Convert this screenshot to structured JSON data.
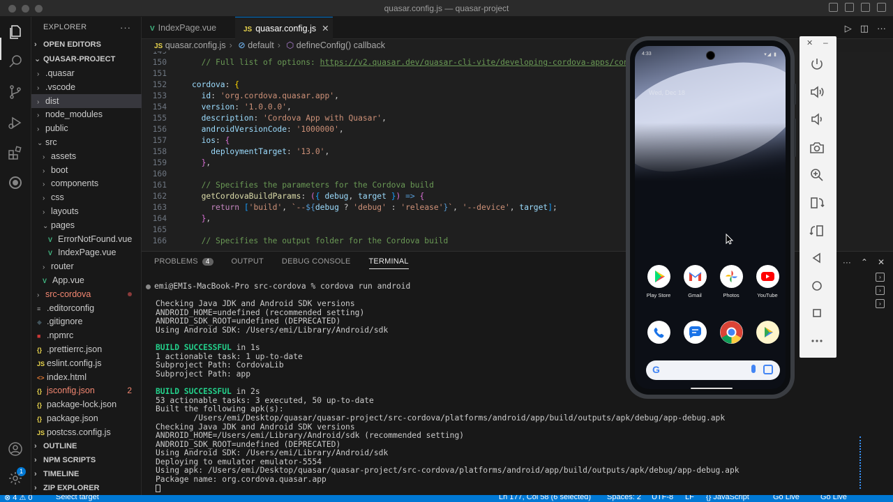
{
  "window": {
    "title": "quasar.config.js — quasar-project"
  },
  "explorer": {
    "header": "EXPLORER",
    "open_editors": "OPEN EDITORS",
    "project": "QUASAR-PROJECT",
    "tree": [
      {
        "label": ".quasar",
        "depth": 1,
        "kind": "folder"
      },
      {
        "label": ".vscode",
        "depth": 1,
        "kind": "folder"
      },
      {
        "label": "dist",
        "depth": 1,
        "kind": "folder",
        "selected": true
      },
      {
        "label": "node_modules",
        "depth": 1,
        "kind": "folder"
      },
      {
        "label": "public",
        "depth": 1,
        "kind": "folder"
      },
      {
        "label": "src",
        "depth": 1,
        "kind": "folder-open"
      },
      {
        "label": "assets",
        "depth": 2,
        "kind": "folder"
      },
      {
        "label": "boot",
        "depth": 2,
        "kind": "folder"
      },
      {
        "label": "components",
        "depth": 2,
        "kind": "folder"
      },
      {
        "label": "css",
        "depth": 2,
        "kind": "folder"
      },
      {
        "label": "layouts",
        "depth": 2,
        "kind": "folder"
      },
      {
        "label": "pages",
        "depth": 2,
        "kind": "folder-open"
      },
      {
        "label": "ErrorNotFound.vue",
        "depth": 3,
        "kind": "vue"
      },
      {
        "label": "IndexPage.vue",
        "depth": 3,
        "kind": "vue"
      },
      {
        "label": "router",
        "depth": 2,
        "kind": "folder"
      },
      {
        "label": "App.vue",
        "depth": 2,
        "kind": "vue"
      },
      {
        "label": "src-cordova",
        "depth": 1,
        "kind": "folder",
        "error": true
      },
      {
        "label": ".editorconfig",
        "depth": 1,
        "kind": "config"
      },
      {
        "label": ".gitignore",
        "depth": 1,
        "kind": "git"
      },
      {
        "label": ".npmrc",
        "depth": 1,
        "kind": "npm"
      },
      {
        "label": ".prettierrc.json",
        "depth": 1,
        "kind": "json"
      },
      {
        "label": "eslint.config.js",
        "depth": 1,
        "kind": "js"
      },
      {
        "label": "index.html",
        "depth": 1,
        "kind": "html"
      },
      {
        "label": "jsconfig.json",
        "depth": 1,
        "kind": "json",
        "error": true,
        "count": "2"
      },
      {
        "label": "package-lock.json",
        "depth": 1,
        "kind": "json"
      },
      {
        "label": "package.json",
        "depth": 1,
        "kind": "json"
      },
      {
        "label": "postcss.config.js",
        "depth": 1,
        "kind": "js"
      }
    ],
    "sections": [
      "OUTLINE",
      "NPM SCRIPTS",
      "TIMELINE",
      "ZIP EXPLORER"
    ]
  },
  "tabs": [
    {
      "label": "IndexPage.vue",
      "icon": "V",
      "active": false
    },
    {
      "label": "quasar.config.js",
      "icon": "JS",
      "active": true
    }
  ],
  "breadcrumb": [
    "quasar.config.js",
    "default",
    "defineConfig() callback"
  ],
  "editor": {
    "lines": [
      {
        "n": "149",
        "text": ""
      },
      {
        "n": "150",
        "text": "// Full list of options: https://v2.quasar.dev/quasar-cli-vite/developing-cordova-apps/configuring-cordova"
      },
      {
        "n": "151",
        "text": ""
      },
      {
        "n": "152",
        "text": "cordova: {"
      },
      {
        "n": "153",
        "text": "id: 'org.cordova.quasar.app',"
      },
      {
        "n": "154",
        "text": "version: '1.0.0.0',"
      },
      {
        "n": "155",
        "text": "description: 'Cordova App with Quasar',"
      },
      {
        "n": "156",
        "text": "androidVersionCode: '1000000',"
      },
      {
        "n": "157",
        "text": "ios: {"
      },
      {
        "n": "158",
        "text": "deploymentTarget: '13.0',"
      },
      {
        "n": "159",
        "text": "},"
      },
      {
        "n": "160",
        "text": ""
      },
      {
        "n": "161",
        "text": "// Specifies the parameters for the Cordova build"
      },
      {
        "n": "162",
        "text": "getCordovaBuildParams: ({ debug, target }) => {"
      },
      {
        "n": "163",
        "text": "return ['build', `--${debug ? 'debug' : 'release'}`, '--device', target];"
      },
      {
        "n": "164",
        "text": "},"
      },
      {
        "n": "165",
        "text": ""
      },
      {
        "n": "166",
        "text": "// Specifies the output folder for the Cordova build"
      }
    ]
  },
  "panel": {
    "tabs": [
      "PROBLEMS",
      "OUTPUT",
      "DEBUG CONSOLE",
      "TERMINAL"
    ],
    "problems_count": "4",
    "active_tab": "TERMINAL",
    "terminal": [
      "emi@EMIs-MacBook-Pro src-cordova % cordova run android",
      "",
      "Checking Java JDK and Android SDK versions",
      "ANDROID_HOME=undefined (recommended setting)",
      "ANDROID_SDK_ROOT=undefined (DEPRECATED)",
      "Using Android SDK: /Users/emi/Library/Android/sdk",
      "",
      "BUILD SUCCESSFUL in 1s",
      "1 actionable task: 1 up-to-date",
      "Subproject Path: CordovaLib",
      "Subproject Path: app",
      "",
      "BUILD SUCCESSFUL in 2s",
      "53 actionable tasks: 3 executed, 50 up-to-date",
      "Built the following apk(s):",
      "        /Users/emi/Desktop/quasar/quasar-project/src-cordova/platforms/android/app/build/outputs/apk/debug/app-debug.apk",
      "Checking Java JDK and Android SDK versions",
      "ANDROID_HOME=/Users/emi/Library/Android/sdk (recommended setting)",
      "ANDROID_SDK_ROOT=undefined (DEPRECATED)",
      "Using Android SDK: /Users/emi/Library/Android/sdk",
      "Deploying to emulator emulator-5554",
      "Using apk: /Users/emi/Desktop/quasar/quasar-project/src-cordova/platforms/android/app/build/outputs/apk/debug/app-debug.apk",
      "Package name: org.cordova.quasar.app",
      ""
    ]
  },
  "statusbar": {
    "problems": "⊗ 4 ⚠ 0",
    "select_target": "Select target",
    "position": "Ln 177, Col 58 (6 selected)",
    "spaces": "Spaces: 2",
    "encoding": "UTF-8",
    "eol": "LF",
    "language": "{} JavaScript",
    "golive1": "Go Live",
    "golive2": "Go Live"
  },
  "phone": {
    "time": "4:33",
    "status": "▾◢ ▮",
    "date": "Wed, Dec 18",
    "apps_row1": [
      "Play Store",
      "Gmail",
      "Photos",
      "YouTube"
    ],
    "apps_row2": [
      "phone-icon",
      "messages-icon",
      "chrome-icon",
      "play-games-icon"
    ]
  },
  "emulator_controls": [
    "power",
    "volume-up",
    "volume-down",
    "camera",
    "zoom",
    "rotate-left",
    "rotate-right",
    "back",
    "home",
    "overview",
    "more"
  ],
  "colors": {
    "accent": "#0078d4",
    "status_bar": "#0078d4",
    "success": "#23d18b",
    "error": "#f48771"
  }
}
